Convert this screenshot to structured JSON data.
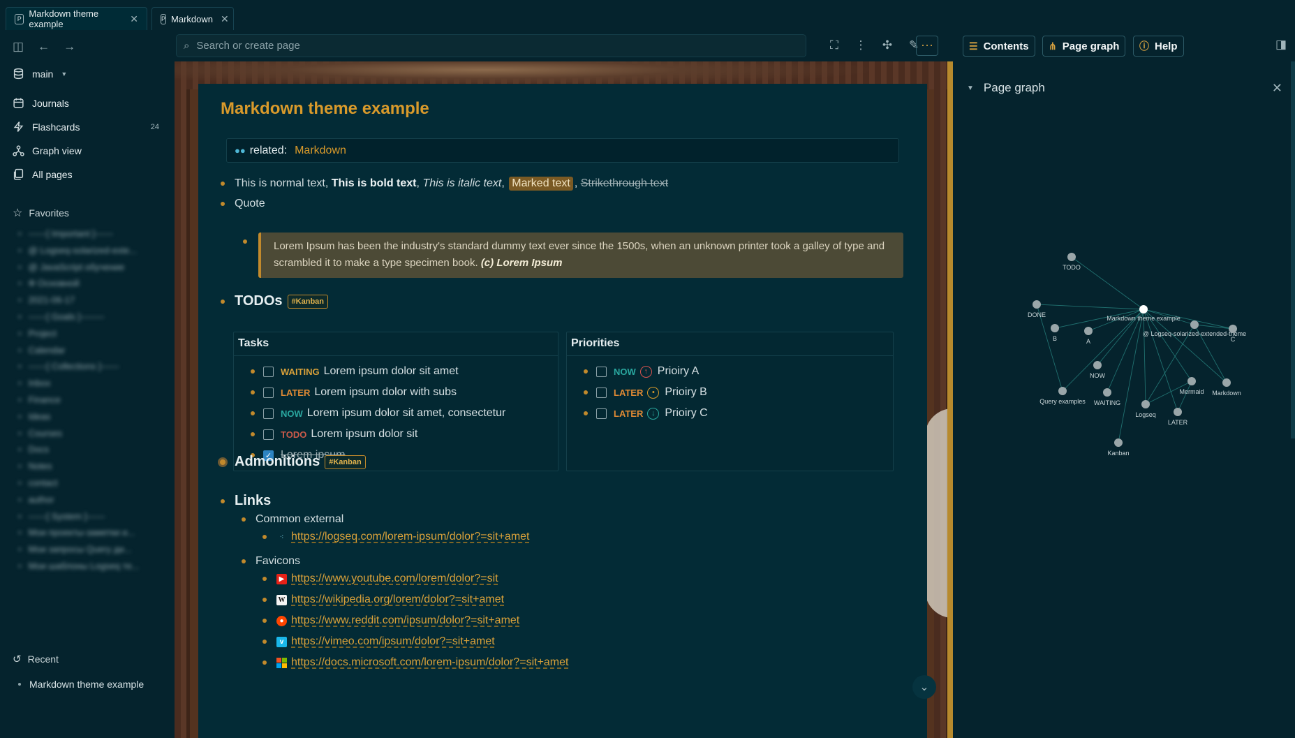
{
  "tabs": [
    {
      "label": "Markdown theme example",
      "icon": "P"
    },
    {
      "label": "Markdown",
      "icon": "P"
    }
  ],
  "sidebar": {
    "workspace": "main",
    "nav": [
      {
        "label": "Journals",
        "icon": "calendar-icon"
      },
      {
        "label": "Flashcards",
        "icon": "bolt-icon",
        "count": "24"
      },
      {
        "label": "Graph view",
        "icon": "graph-icon"
      },
      {
        "label": "All pages",
        "icon": "pages-icon"
      }
    ],
    "favorites_label": "Favorites",
    "favorites": [
      "------[ Important ]------",
      "@ Logseq-solarized-exte...",
      "@ JavaScript обучение",
      "Ф Основной",
      "2021-06-17",
      "------[ Goals ]--------",
      "Project",
      "Calendar",
      "------[ Collections ]------",
      "Inbox",
      "Finance",
      "Ideas",
      "Courses",
      "Docs",
      "Notes",
      "contact",
      "author",
      "------[ System ]------",
      "Мои проекты-заметки и...",
      "Мои запросы Query ди...",
      "Мои шаблоны Logseq те..."
    ],
    "recent_label": "Recent",
    "recent": [
      "Markdown theme example"
    ]
  },
  "search": {
    "placeholder": "Search or create page"
  },
  "right_toolbar": {
    "contents": "Contents",
    "page_graph": "Page graph",
    "help": "Help"
  },
  "page": {
    "title": "Markdown theme example",
    "property": {
      "key": "related:",
      "value": "Markdown"
    },
    "text_line": {
      "normal": "This is normal text,",
      "bold": "This is bold text",
      "sep1": ",",
      "italic": "This is italic text",
      "sep2": ",",
      "marked": "Marked text",
      "sep3": ",",
      "strike": "Strikethrough text"
    },
    "quote_label": "Quote",
    "quote_text": "Lorem Ipsum has been the industry's standard dummy text ever since the 1500s, when an unknown printer took a galley of type and scrambled it to make a type specimen book.",
    "quote_cite": "(c) Lorem Ipsum",
    "todos": {
      "heading": "TODOs",
      "tag": "#Kanban",
      "tasks_header": "Tasks",
      "tasks": [
        {
          "marker": "WAITING",
          "text": "Lorem ipsum dolor sit amet"
        },
        {
          "marker": "LATER",
          "text": "Lorem ipsum dolor with subs"
        },
        {
          "marker": "NOW",
          "text": "Lorem ipsum dolor sit amet, consectetur"
        },
        {
          "marker": "TODO",
          "text": "Lorem ipsum dolor sit"
        },
        {
          "marker": "",
          "text": "Lorem ipsum"
        }
      ],
      "priorities_header": "Priorities",
      "priorities": [
        {
          "marker": "NOW",
          "text": "Prioiry A"
        },
        {
          "marker": "LATER",
          "text": "Prioiry B"
        },
        {
          "marker": "LATER",
          "text": "Prioiry C"
        }
      ]
    },
    "admonitions": {
      "heading": "Admonitions",
      "tag": "#Kanban"
    },
    "links": {
      "heading": "Links",
      "common_label": "Common external",
      "common": [
        "https://logseq.com/lorem-ipsum/dolor?=sit+amet"
      ],
      "favicons_label": "Favicons",
      "favicons": [
        "https://www.youtube.com/lorem/dolor?=sit",
        "https://wikipedia.org/lorem/dolor?=sit+amet",
        "https://www.reddit.com/ipsum/dolor?=sit+amet",
        "https://vimeo.com/ipsum/dolor?=sit+amet",
        "https://docs.microsoft.com/lorem-ipsum/dolor?=sit+amet"
      ]
    }
  },
  "page_graph": {
    "title": "Page graph",
    "nodes": [
      "TODO",
      "DONE",
      "B",
      "A",
      "Markdown theme example",
      "@ Logseq-solarized-extended-theme",
      "C",
      "NOW",
      "Mermaid",
      "Markdown",
      "Query examples",
      "WAITING",
      "Logseq",
      "LATER",
      "Kanban"
    ]
  },
  "colors": {
    "accent": "#d99a2b",
    "background": "#002b36",
    "sidebar": "#05232d"
  }
}
